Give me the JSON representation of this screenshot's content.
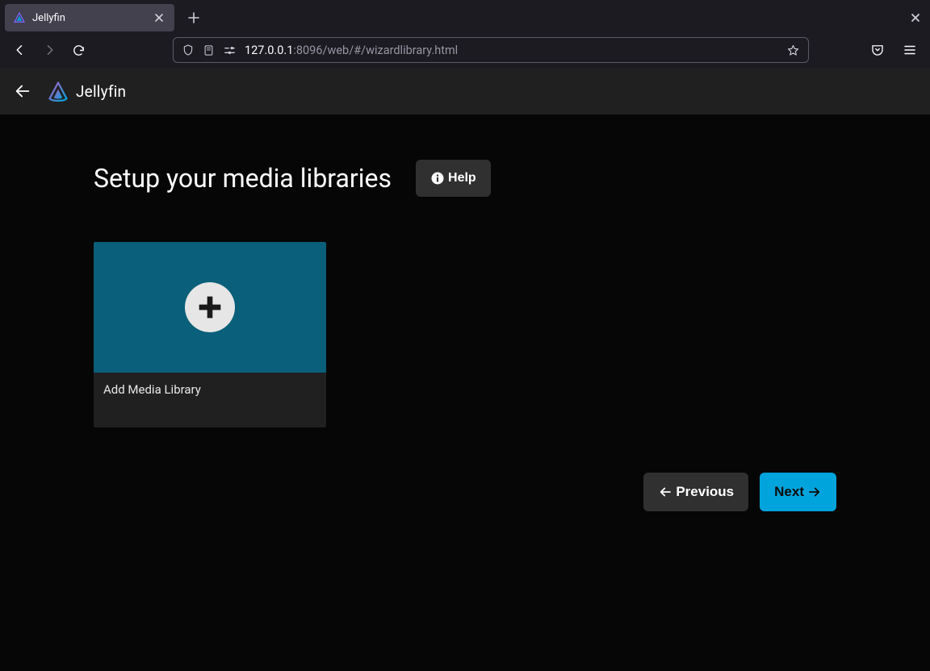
{
  "browser": {
    "tab_title": "Jellyfin",
    "url_prefix": "127.0.0.1",
    "url_suffix": ":8096/web/#/wizardlibrary.html"
  },
  "app": {
    "brand_name": "Jellyfin"
  },
  "page": {
    "title": "Setup your media libraries",
    "help_label": "Help",
    "card_label": "Add Media Library",
    "previous_label": "Previous",
    "next_label": "Next"
  },
  "colors": {
    "accent": "#00a4dc",
    "card_media": "#0a5f7a",
    "surface": "#202020",
    "surface2": "#303030"
  }
}
